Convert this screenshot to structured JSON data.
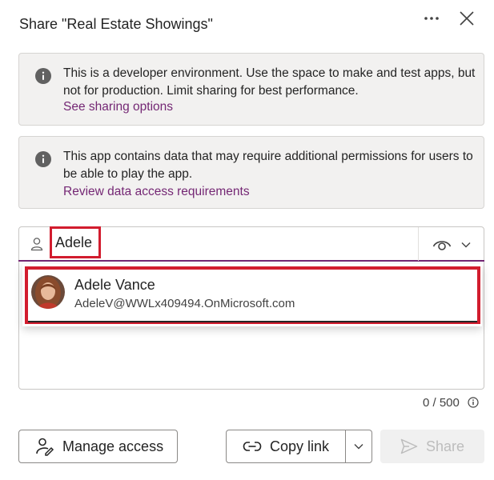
{
  "dialog": {
    "title": "Share \"Real Estate Showings\"",
    "more_icon": "ellipsis-icon",
    "close_icon": "close-icon"
  },
  "notices": [
    {
      "icon": "info-icon",
      "text": "This is a developer environment. Use the space to make and test apps, but not for production. Limit sharing for best performance.",
      "link": "See sharing options"
    },
    {
      "icon": "info-icon",
      "text": "This app contains data that may require additional permissions for users to be able to play the app.",
      "link": "Review data access requirements"
    }
  ],
  "people_picker": {
    "icon": "person-icon",
    "value": "Adele",
    "permission_icon": "eye-icon"
  },
  "suggestion": {
    "name": "Adele Vance",
    "email": "AdeleV@WWLx409494.OnMicrosoft.com"
  },
  "counter": {
    "text": "0 / 500"
  },
  "footer": {
    "manage_access": "Manage access",
    "copy_link": "Copy link",
    "share": "Share"
  },
  "colors": {
    "accent": "#742774",
    "highlight": "#d21c2e",
    "notice_bg": "#f2f1f0"
  }
}
